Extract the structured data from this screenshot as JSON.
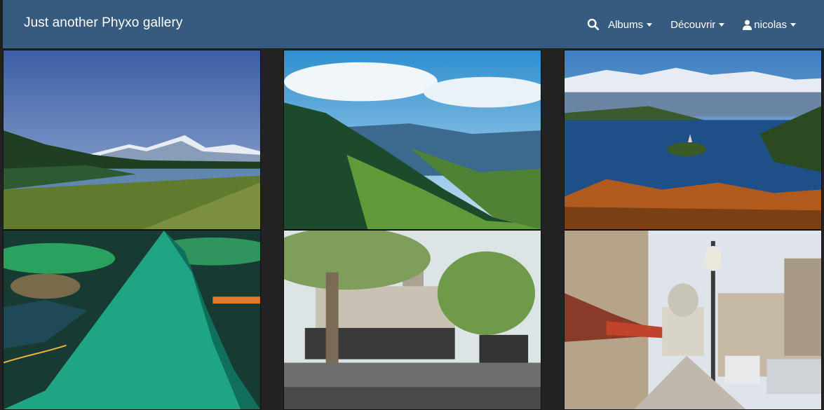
{
  "navbar": {
    "brand": "Just another Phyxo gallery",
    "search_icon": "search-icon",
    "items": [
      {
        "label": "Albums",
        "has_caret": true
      },
      {
        "label": "Découvrir",
        "has_caret": true
      }
    ],
    "user": {
      "label": "nicolas",
      "icon": "user-icon",
      "has_caret": true
    }
  },
  "gallery": {
    "thumbnails": [
      {
        "subject": "mountain-lake-meadow"
      },
      {
        "subject": "green-valley-hills"
      },
      {
        "subject": "lake-island-church"
      },
      {
        "subject": "aurora-snowy-peak"
      },
      {
        "subject": "paris-bookstalls-building"
      },
      {
        "subject": "paris-street-pantheon"
      }
    ]
  },
  "colors": {
    "navbar_bg": "#375a7f",
    "page_bg": "#222222",
    "text": "#ffffff"
  }
}
